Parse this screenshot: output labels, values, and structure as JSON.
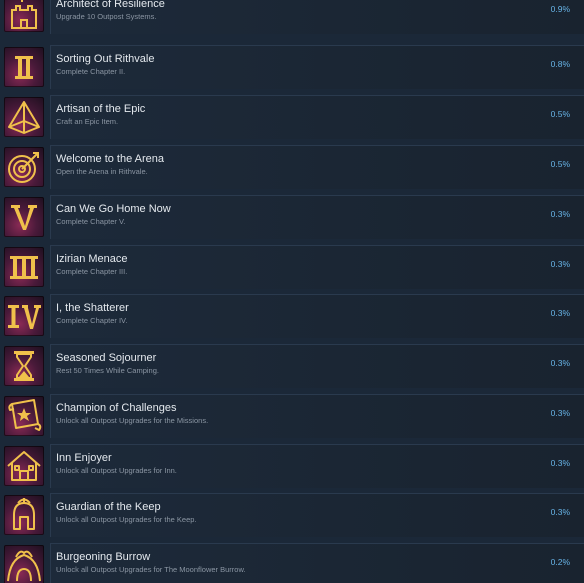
{
  "achievements": [
    {
      "title": "Architect of Resilience",
      "description": "Upgrade 10 Outpost Systems.",
      "percent": "0.9%",
      "icon": "castle-icon"
    },
    {
      "title": "Sorting Out Rithvale",
      "description": "Complete Chapter II.",
      "percent": "0.8%",
      "icon": "roman-numeral-2-icon"
    },
    {
      "title": "Artisan of the Epic",
      "description": "Craft an Epic Item.",
      "percent": "0.5%",
      "icon": "pyramid-gem-icon"
    },
    {
      "title": "Welcome to the Arena",
      "description": "Open the Arena in Rithvale.",
      "percent": "0.5%",
      "icon": "target-icon"
    },
    {
      "title": "Can We Go Home Now",
      "description": "Complete Chapter V.",
      "percent": "0.3%",
      "icon": "roman-numeral-5-icon"
    },
    {
      "title": "Izirian Menace",
      "description": "Complete Chapter III.",
      "percent": "0.3%",
      "icon": "roman-numeral-3-icon"
    },
    {
      "title": "I, the Shatterer",
      "description": "Complete Chapter IV.",
      "percent": "0.3%",
      "icon": "roman-numeral-4-icon"
    },
    {
      "title": "Seasoned Sojourner",
      "description": "Rest 50 Times While Camping.",
      "percent": "0.3%",
      "icon": "hourglass-icon"
    },
    {
      "title": "Champion of Challenges",
      "description": "Unlock all Outpost Upgrades for the Missions.",
      "percent": "0.3%",
      "icon": "scroll-icon"
    },
    {
      "title": "Inn Enjoyer",
      "description": "Unlock all Outpost Upgrades for Inn.",
      "percent": "0.3%",
      "icon": "house-icon"
    },
    {
      "title": "Guardian of the Keep",
      "description": "Unlock all Outpost Upgrades for the Keep.",
      "percent": "0.3%",
      "icon": "helmet-icon"
    },
    {
      "title": "Burgeoning Burrow",
      "description": "Unlock all Outpost Upgrades for The Moonflower Burrow.",
      "percent": "0.2%",
      "icon": "burrow-icon"
    }
  ]
}
